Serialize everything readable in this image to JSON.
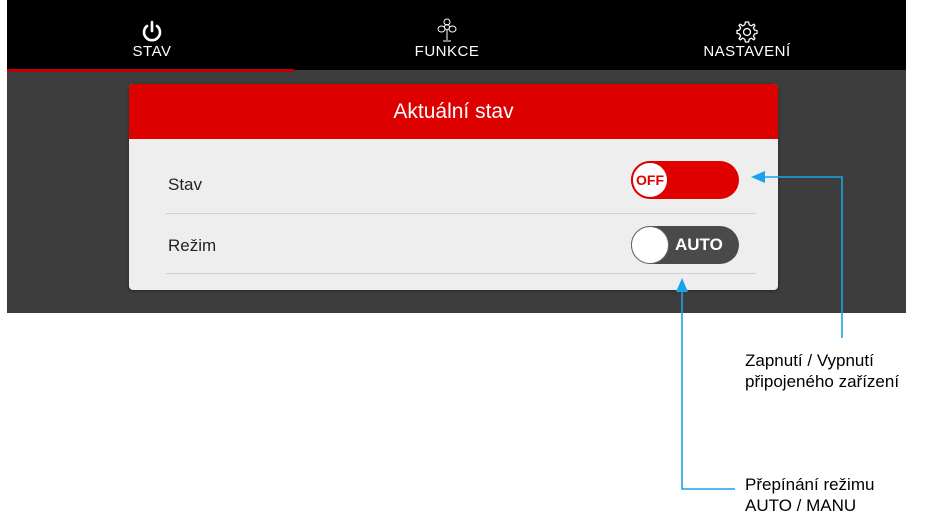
{
  "tabs": [
    {
      "label": "STAV",
      "icon": "power-icon"
    },
    {
      "label": "FUNKCE",
      "icon": "fan-icon"
    },
    {
      "label": "NASTAVENÍ",
      "icon": "gear-icon"
    }
  ],
  "active_tab": "STAV",
  "card": {
    "title": "Aktuální stav",
    "rows": [
      {
        "label": "Stav",
        "control": "toggle",
        "value": "OFF"
      },
      {
        "label": "Režim",
        "control": "toggle",
        "value": "AUTO"
      }
    ]
  },
  "annotations": {
    "power_line1": "Zapnutí / Vypnutí",
    "power_line2": "připojeného zařízení",
    "mode_line1": "Přepínání režimu",
    "mode_line2": "AUTO / MANU"
  },
  "colors": {
    "accent": "#dd0000",
    "arrow": "#1aa3e8",
    "background": "#3d3d3d"
  }
}
